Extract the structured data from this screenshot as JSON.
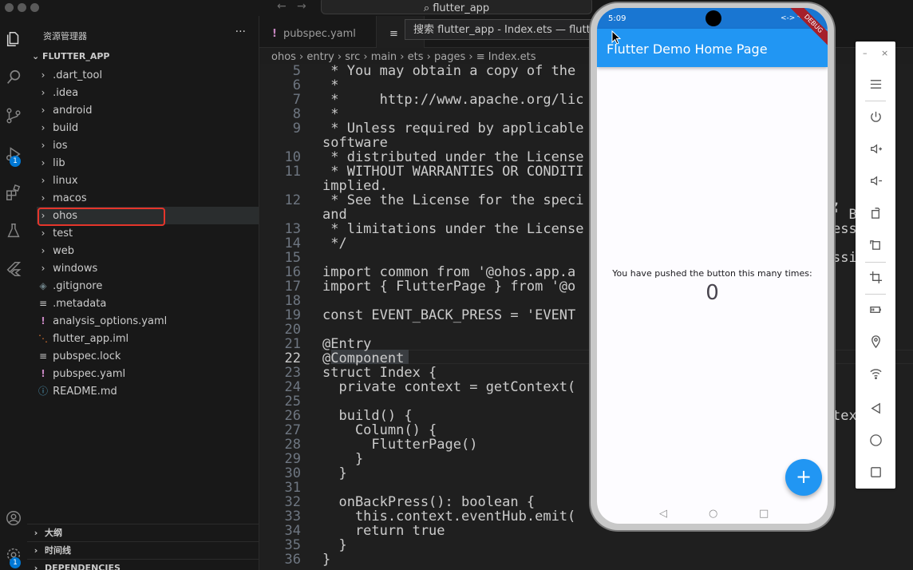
{
  "titlebar": {
    "command_center": "flutter_app",
    "tooltip": "搜索 flutter_app - Index.ets — flutter_app"
  },
  "activity_bar": {
    "run_badge": "1",
    "settings_badge": "1"
  },
  "sidebar": {
    "title": "资源管理器",
    "more": "···",
    "root": "FLUTTER_APP",
    "items": [
      {
        "label": ".dart_tool",
        "type": "folder"
      },
      {
        "label": ".idea",
        "type": "folder"
      },
      {
        "label": "android",
        "type": "folder"
      },
      {
        "label": "build",
        "type": "folder"
      },
      {
        "label": "ios",
        "type": "folder"
      },
      {
        "label": "lib",
        "type": "folder"
      },
      {
        "label": "linux",
        "type": "folder"
      },
      {
        "label": "macos",
        "type": "folder"
      },
      {
        "label": "ohos",
        "type": "folder"
      },
      {
        "label": "test",
        "type": "folder"
      },
      {
        "label": "web",
        "type": "folder"
      },
      {
        "label": "windows",
        "type": "folder"
      },
      {
        "label": ".gitignore",
        "type": "file"
      },
      {
        "label": ".metadata",
        "type": "file"
      },
      {
        "label": "analysis_options.yaml",
        "type": "file"
      },
      {
        "label": "flutter_app.iml",
        "type": "file"
      },
      {
        "label": "pubspec.lock",
        "type": "file"
      },
      {
        "label": "pubspec.yaml",
        "type": "file"
      },
      {
        "label": "README.md",
        "type": "file"
      }
    ],
    "sections": [
      "大纲",
      "时间线",
      "DEPENDENCIES"
    ]
  },
  "tabs": [
    {
      "label": "pubspec.yaml",
      "mark": "!"
    },
    {
      "label": "",
      "mark": "≡"
    }
  ],
  "breadcrumb": [
    "ohos",
    "entry",
    "src",
    "main",
    "ets",
    "pages",
    "Index.ets"
  ],
  "editor": {
    "lines": [
      {
        "n": "5",
        "text": " * You may obtain a copy of the"
      },
      {
        "n": "6",
        "text": " *"
      },
      {
        "n": "7",
        "text": " *     http://www.apache.org/lic"
      },
      {
        "n": "8",
        "text": " *"
      },
      {
        "n": "9",
        "text": " * Unless required by applicable"
      },
      {
        "n": "",
        "text": "software"
      },
      {
        "n": "10",
        "text": " * distributed under the License"
      },
      {
        "n": "11",
        "text": " * WITHOUT WARRANTIES OR CONDITI"
      },
      {
        "n": "",
        "text": "implied."
      },
      {
        "n": "12",
        "text": " * See the License for the speci"
      },
      {
        "n": "",
        "text": "and"
      },
      {
        "n": "13",
        "text": " * limitations under the License"
      },
      {
        "n": "14",
        "text": " */"
      },
      {
        "n": "15",
        "text": ""
      },
      {
        "n": "16",
        "text": "import common from '@ohos.app.a"
      },
      {
        "n": "17",
        "text": "import { FlutterPage } from '@o"
      },
      {
        "n": "18",
        "text": ""
      },
      {
        "n": "19",
        "text": "const EVENT_BACK_PRESS = 'EVENT"
      },
      {
        "n": "20",
        "text": ""
      },
      {
        "n": "21",
        "text": "@Entry"
      },
      {
        "n": "22",
        "text": "@Component"
      },
      {
        "n": "23",
        "text": "struct Index {"
      },
      {
        "n": "24",
        "text": "  private context = getContext("
      },
      {
        "n": "25",
        "text": ""
      },
      {
        "n": "26",
        "text": "  build() {"
      },
      {
        "n": "27",
        "text": "    Column() {"
      },
      {
        "n": "28",
        "text": "      FlutterPage()"
      },
      {
        "n": "29",
        "text": "    }"
      },
      {
        "n": "30",
        "text": "  }"
      },
      {
        "n": "31",
        "text": ""
      },
      {
        "n": "32",
        "text": "  onBackPress(): boolean {"
      },
      {
        "n": "33",
        "text": "    this.context.eventHub.emit("
      },
      {
        "n": "34",
        "text": "    return true"
      },
      {
        "n": "35",
        "text": "  }"
      },
      {
        "n": "36",
        "text": "}"
      }
    ],
    "right_fragments": [
      {
        "row": 9,
        "text": ","
      },
      {
        "row": 10,
        "text": "' B"
      },
      {
        "row": 11,
        "text": "ess"
      },
      {
        "row": 13,
        "text": "ssi"
      },
      {
        "row": 24,
        "text": "tex"
      }
    ]
  },
  "phone": {
    "time": "5:09",
    "status_icons": "<-> ⁴ᴳ ▮",
    "appbar_title": "Flutter Demo Home Page",
    "debug": "DEBUG",
    "counter_label": "You have pushed the button this many times:",
    "counter_value": "0",
    "fab": "+",
    "nav_back": "◁",
    "nav_home": "○",
    "nav_recent": "□"
  },
  "emulator_toolbar": {
    "minimize": "–",
    "close": "×"
  }
}
